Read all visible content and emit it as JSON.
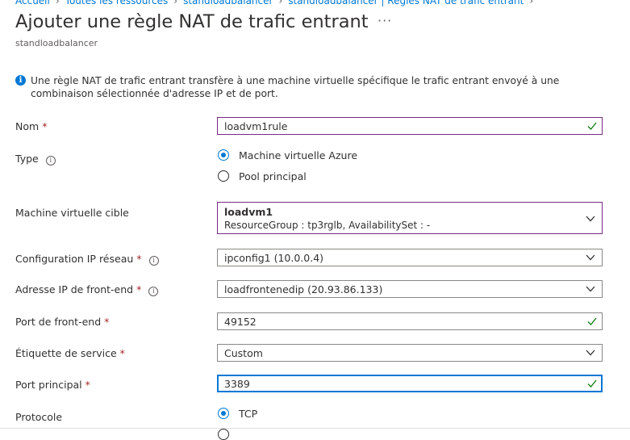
{
  "breadcrumb": [
    {
      "label": "Accueil"
    },
    {
      "label": "Toutes les ressources"
    },
    {
      "label": "standloadbalancer"
    },
    {
      "label": "standloadbalancer | Règles NAT de trafic entrant"
    }
  ],
  "header": {
    "title": "Ajouter une règle NAT de trafic entrant",
    "more": "···",
    "subtitle": "standloadbalancer"
  },
  "info": {
    "icon": "info-icon",
    "text": "Une règle NAT de trafic entrant transfère à une machine virtuelle spécifique le trafic entrant envoyé à une combinaison sélectionnée d'adresse IP et de port."
  },
  "form": {
    "name": {
      "label": "Nom",
      "required": "*",
      "value": "loadvm1rule"
    },
    "type": {
      "label": "Type",
      "options": [
        "Machine virtuelle Azure",
        "Pool principal"
      ],
      "selected": "Machine virtuelle Azure"
    },
    "target_vm": {
      "label": "Machine virtuelle cible",
      "value_name": "loadvm1",
      "value_meta": "ResourceGroup : tp3rglb, AvailabilitySet : -"
    },
    "ip_config": {
      "label": "Configuration IP réseau",
      "required": "*",
      "value": "ipconfig1 (10.0.0.4)"
    },
    "frontend_ip": {
      "label": "Adresse IP de front-end",
      "required": "*",
      "value": "loadfrontenedip (20.93.86.133)"
    },
    "frontend_port": {
      "label": "Port de front-end",
      "required": "*",
      "value": "49152"
    },
    "service_tag": {
      "label": "Étiquette de service",
      "required": "*",
      "value": "Custom"
    },
    "backend_port": {
      "label": "Port principal",
      "required": "*",
      "value": "3389"
    },
    "protocol": {
      "label": "Protocole",
      "options": [
        "TCP"
      ],
      "selected": "TCP"
    }
  },
  "colors": {
    "accent": "#0078d4",
    "valid": "#107c10",
    "required": "#a4262c",
    "field_border_valid": "#7a2a87"
  }
}
